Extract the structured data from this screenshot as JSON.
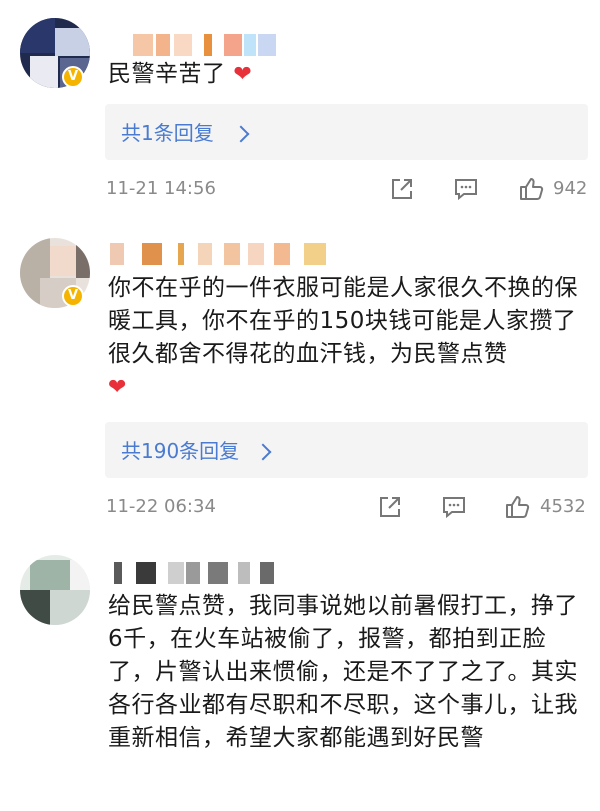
{
  "comments": [
    {
      "text": "民警辛苦了",
      "reply_label": "共1条回复",
      "time": "11-21 14:56",
      "likes": "942"
    },
    {
      "text": "你不在乎的一件衣服可能是人家很久不换的保暖工具，你不在乎的150块钱可能是人家攒了很久都舍不得花的血汗钱，为民警点赞",
      "reply_label": "共190条回复",
      "time": "11-22 06:34",
      "likes": "4532"
    },
    {
      "text": "给民警点赞，我同事说她以前暑假打工，挣了6千，在火车站被偷了，报警，都拍到正脸了，片警认出来惯偷，还是不了了之了。其实各行各业都有尽职和不尽职，这个事儿，让我重新相信，希望大家都能遇到好民警"
    }
  ],
  "colors": {
    "link": "#4a7bd0",
    "heart": "#e8303a",
    "meta": "#8a8a8a",
    "reply_bg": "#f4f4f4",
    "verified_badge": "#f5b400"
  },
  "icons": [
    "share-icon",
    "comment-icon",
    "like-icon",
    "heart-emoji",
    "verified-badge-icon",
    "chevron-right-icon"
  ]
}
